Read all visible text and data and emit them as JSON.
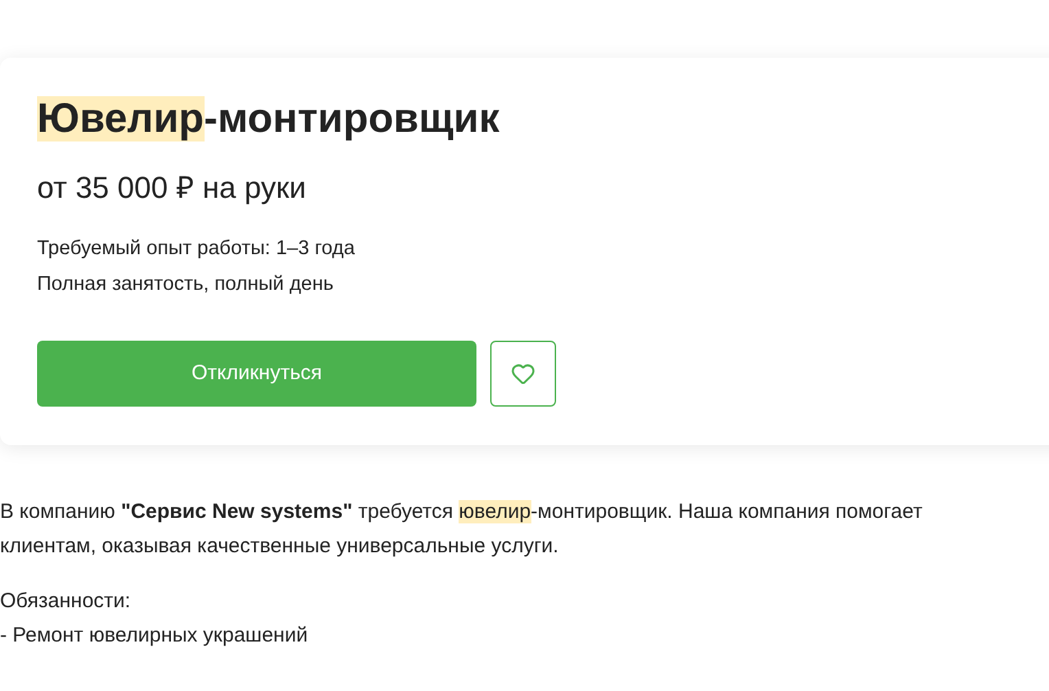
{
  "vacancy": {
    "title": [
      {
        "text": "Ювелир",
        "highlighted": true
      },
      {
        "text": "-монтировщик",
        "highlighted": false
      }
    ],
    "salary": "от 35 000 ₽ на руки",
    "details": [
      "Требуемый опыт работы: 1–3 года",
      "Полная занятость, полный день"
    ],
    "apply_button": "Откликнуться",
    "favorite": {
      "selected": false
    }
  },
  "description": {
    "paragraphs": [
      {
        "segments": [
          {
            "text": "В компанию ",
            "bold": false,
            "highlighted": false
          },
          {
            "text": "\"Сервис New systems\"",
            "bold": true,
            "highlighted": false
          },
          {
            "text": " требуется ",
            "bold": false,
            "highlighted": false
          },
          {
            "text": "ювелир",
            "bold": false,
            "highlighted": true
          },
          {
            "text": "-монтировщик. Наша компания помогает клиентам, оказывая качественные универсальные услуги.",
            "bold": false,
            "highlighted": false
          }
        ]
      },
      {
        "lines": [
          "Обязанности:",
          "- Ремонт ювелирных украшений"
        ]
      }
    ]
  }
}
